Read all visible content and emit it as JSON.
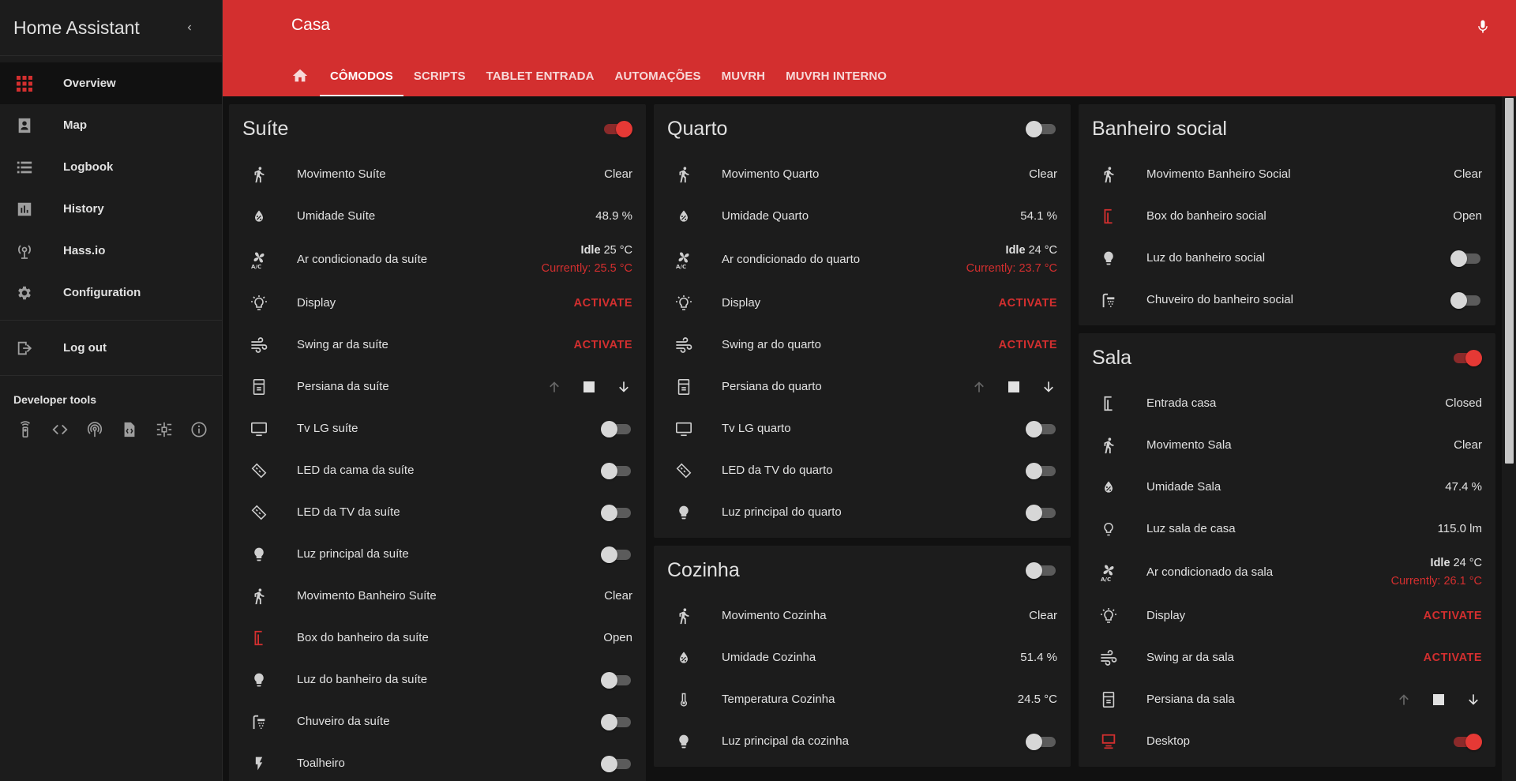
{
  "sidebar": {
    "title": "Home Assistant",
    "items": [
      {
        "label": "Overview",
        "icon": "view-dashboard-icon",
        "active": true
      },
      {
        "label": "Map",
        "icon": "map-account-icon"
      },
      {
        "label": "Logbook",
        "icon": "logbook-list-icon"
      },
      {
        "label": "History",
        "icon": "chart-box-icon"
      },
      {
        "label": "Hass.io",
        "icon": "hassio-icon"
      },
      {
        "label": "Configuration",
        "icon": "gear-icon"
      },
      {
        "label": "Log out",
        "icon": "exit-icon"
      }
    ],
    "developer_tools_title": "Developer tools",
    "developer_tools": [
      "remote-icon",
      "code-icon",
      "broadcast-icon",
      "file-code-icon",
      "timeline-icon",
      "info-icon"
    ]
  },
  "header": {
    "title": "Casa",
    "tabs": [
      "CÔMODOS",
      "SCRIPTS",
      "TABLET ENTRADA",
      "AUTOMAÇÕES",
      "MUVRH",
      "MUVRH INTERNO"
    ],
    "active_tab": "CÔMODOS"
  },
  "colors": {
    "accent": "#d32f2f",
    "background": "#111111",
    "card": "#1c1c1c",
    "sidebar": "#1c1c1c"
  },
  "cards": {
    "suite": {
      "title": "Suíte",
      "toggle_on": true,
      "rows": {
        "movimento": {
          "name": "Movimento Suíte",
          "value": "Clear"
        },
        "umidade": {
          "name": "Umidade Suíte",
          "value": "48.9 %"
        },
        "ar": {
          "name": "Ar condicionado da suíte",
          "state": "Idle",
          "target": "25 °C",
          "current": "Currently: 25.5 °C"
        },
        "display": {
          "name": "Display",
          "action": "ACTIVATE"
        },
        "swing": {
          "name": "Swing ar da suíte",
          "action": "ACTIVATE"
        },
        "persiana": {
          "name": "Persiana da suíte"
        },
        "tv": {
          "name": "Tv LG suíte",
          "on": false
        },
        "led_cama": {
          "name": "LED da cama da suíte",
          "on": false
        },
        "led_tv": {
          "name": "LED da TV da suíte",
          "on": false
        },
        "luz_principal": {
          "name": "Luz principal da suíte",
          "on": false
        },
        "mov_banheiro": {
          "name": "Movimento Banheiro Suíte",
          "value": "Clear"
        },
        "box": {
          "name": "Box do banheiro da suíte",
          "value": "Open"
        },
        "luz_banheiro": {
          "name": "Luz do banheiro da suíte",
          "on": false
        },
        "chuveiro": {
          "name": "Chuveiro da suíte",
          "on": false
        },
        "toalheiro": {
          "name": "Toalheiro",
          "on": false
        }
      }
    },
    "quarto": {
      "title": "Quarto",
      "toggle_on": false,
      "rows": {
        "movimento": {
          "name": "Movimento Quarto",
          "value": "Clear"
        },
        "umidade": {
          "name": "Umidade Quarto",
          "value": "54.1 %"
        },
        "ar": {
          "name": "Ar condicionado do quarto",
          "state": "Idle",
          "target": "24 °C",
          "current": "Currently: 23.7 °C"
        },
        "display": {
          "name": "Display",
          "action": "ACTIVATE"
        },
        "swing": {
          "name": "Swing ar do quarto",
          "action": "ACTIVATE"
        },
        "persiana": {
          "name": "Persiana do quarto"
        },
        "tv": {
          "name": "Tv LG quarto",
          "on": false
        },
        "led_tv": {
          "name": "LED da TV do quarto",
          "on": false
        },
        "luz_principal": {
          "name": "Luz principal do quarto",
          "on": false
        }
      }
    },
    "cozinha": {
      "title": "Cozinha",
      "toggle_on": false,
      "rows": {
        "movimento": {
          "name": "Movimento Cozinha",
          "value": "Clear"
        },
        "umidade": {
          "name": "Umidade Cozinha",
          "value": "51.4 %"
        },
        "temperatura": {
          "name": "Temperatura Cozinha",
          "value": "24.5 °C"
        },
        "luz_principal": {
          "name": "Luz principal da cozinha",
          "on": false
        }
      }
    },
    "banheiro_social": {
      "title": "Banheiro social",
      "rows": {
        "movimento": {
          "name": "Movimento Banheiro Social",
          "value": "Clear"
        },
        "box": {
          "name": "Box do banheiro social",
          "value": "Open"
        },
        "luz": {
          "name": "Luz do banheiro social",
          "on": false
        },
        "chuveiro": {
          "name": "Chuveiro do banheiro social",
          "on": false
        }
      }
    },
    "sala": {
      "title": "Sala",
      "toggle_on": true,
      "rows": {
        "entrada": {
          "name": "Entrada casa",
          "value": "Closed"
        },
        "movimento": {
          "name": "Movimento Sala",
          "value": "Clear"
        },
        "umidade": {
          "name": "Umidade Sala",
          "value": "47.4 %"
        },
        "luz_sala": {
          "name": "Luz sala de casa",
          "value": "115.0 lm"
        },
        "ar": {
          "name": "Ar condicionado da sala",
          "state": "Idle",
          "target": "24 °C",
          "current": "Currently: 26.1 °C"
        },
        "display": {
          "name": "Display",
          "action": "ACTIVATE"
        },
        "swing": {
          "name": "Swing ar da sala",
          "action": "ACTIVATE"
        },
        "persiana": {
          "name": "Persiana da sala"
        },
        "desktop": {
          "name": "Desktop",
          "on": true
        }
      }
    }
  }
}
